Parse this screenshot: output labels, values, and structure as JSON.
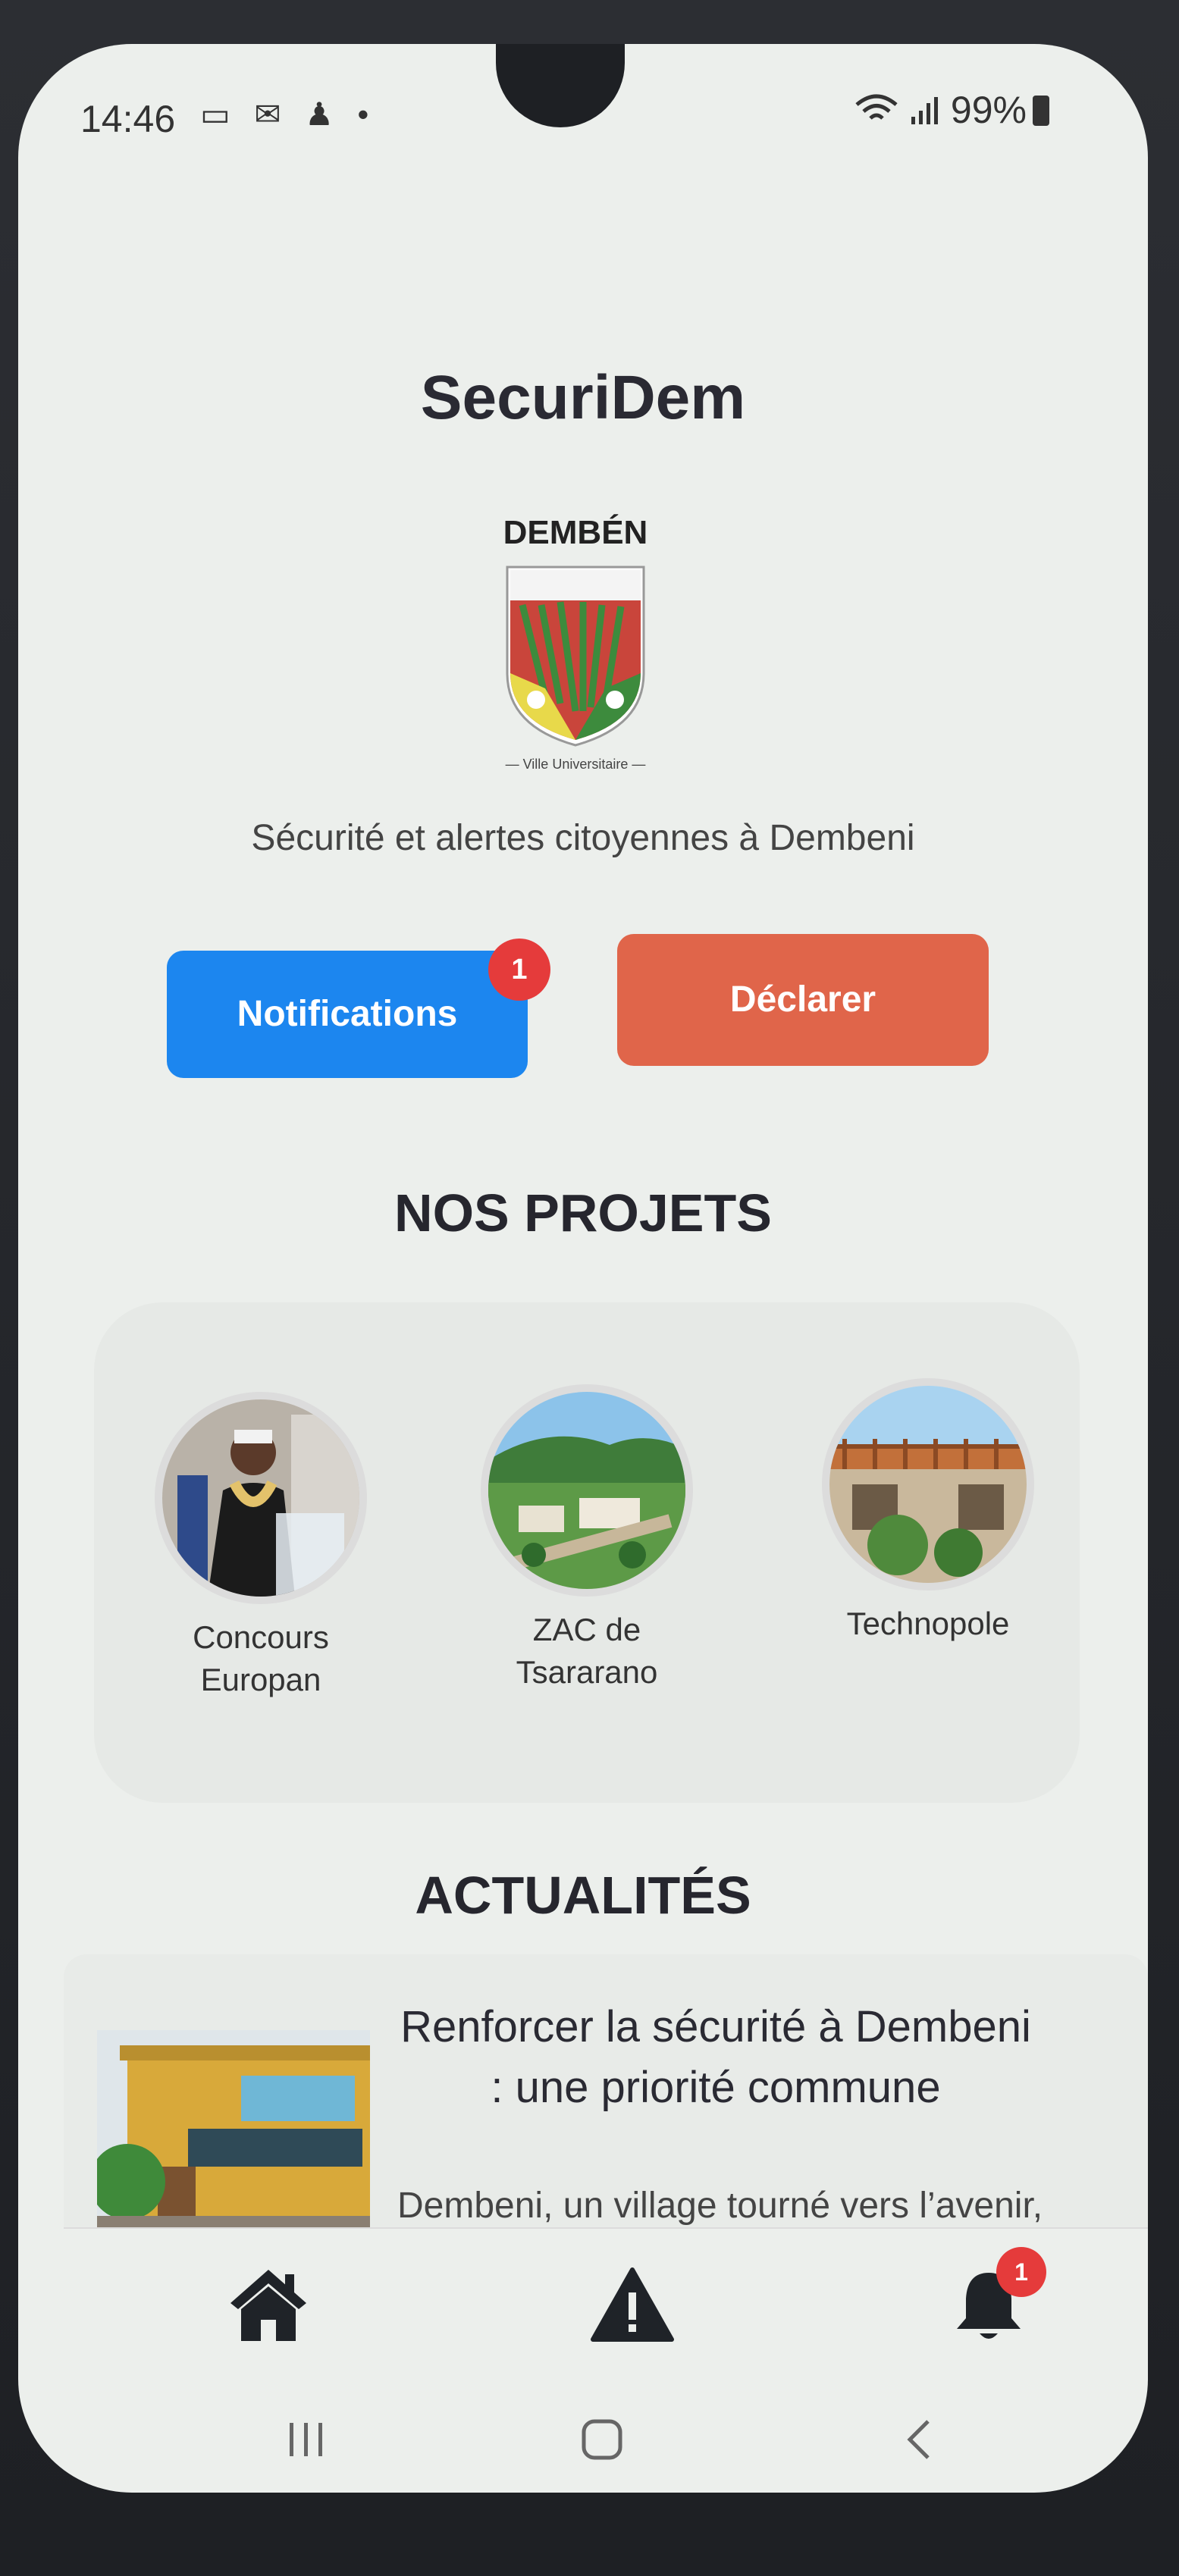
{
  "status": {
    "time": "14:46",
    "left_icons": "▭ ✉ ♟ •",
    "battery": "99%"
  },
  "app": {
    "title": "SecuriDem",
    "logo_word": "DEMBÉN",
    "logo_tagline": "— Ville Universitaire —",
    "subtitle": "Sécurité et alertes citoyennes à Dembeni"
  },
  "actions": {
    "notifications_label": "Notifications",
    "notifications_badge": "1",
    "declare_label": "Déclarer"
  },
  "projects": {
    "title": "NOS PROJETS",
    "items": [
      {
        "label_line1": "Concours",
        "label_line2": "Europan"
      },
      {
        "label_line1": "ZAC de",
        "label_line2": "Tsararano"
      },
      {
        "label_line1": "Technopole",
        "label_line2": ""
      }
    ]
  },
  "news": {
    "title": "ACTUALITÉS",
    "items": [
      {
        "headline": "Renforcer la sécurité à Dembeni : une priorité commune",
        "snippet": "Dembeni, un village tourné vers l’avenir,"
      }
    ]
  },
  "bottom_nav": {
    "items": [
      {
        "icon": "home-icon"
      },
      {
        "icon": "warning-icon"
      },
      {
        "icon": "bell-icon",
        "badge": "1"
      }
    ]
  },
  "colors": {
    "primary_blue": "#1c86ef",
    "declare_orange": "#e0654a",
    "badge_red": "#e53b3b"
  }
}
